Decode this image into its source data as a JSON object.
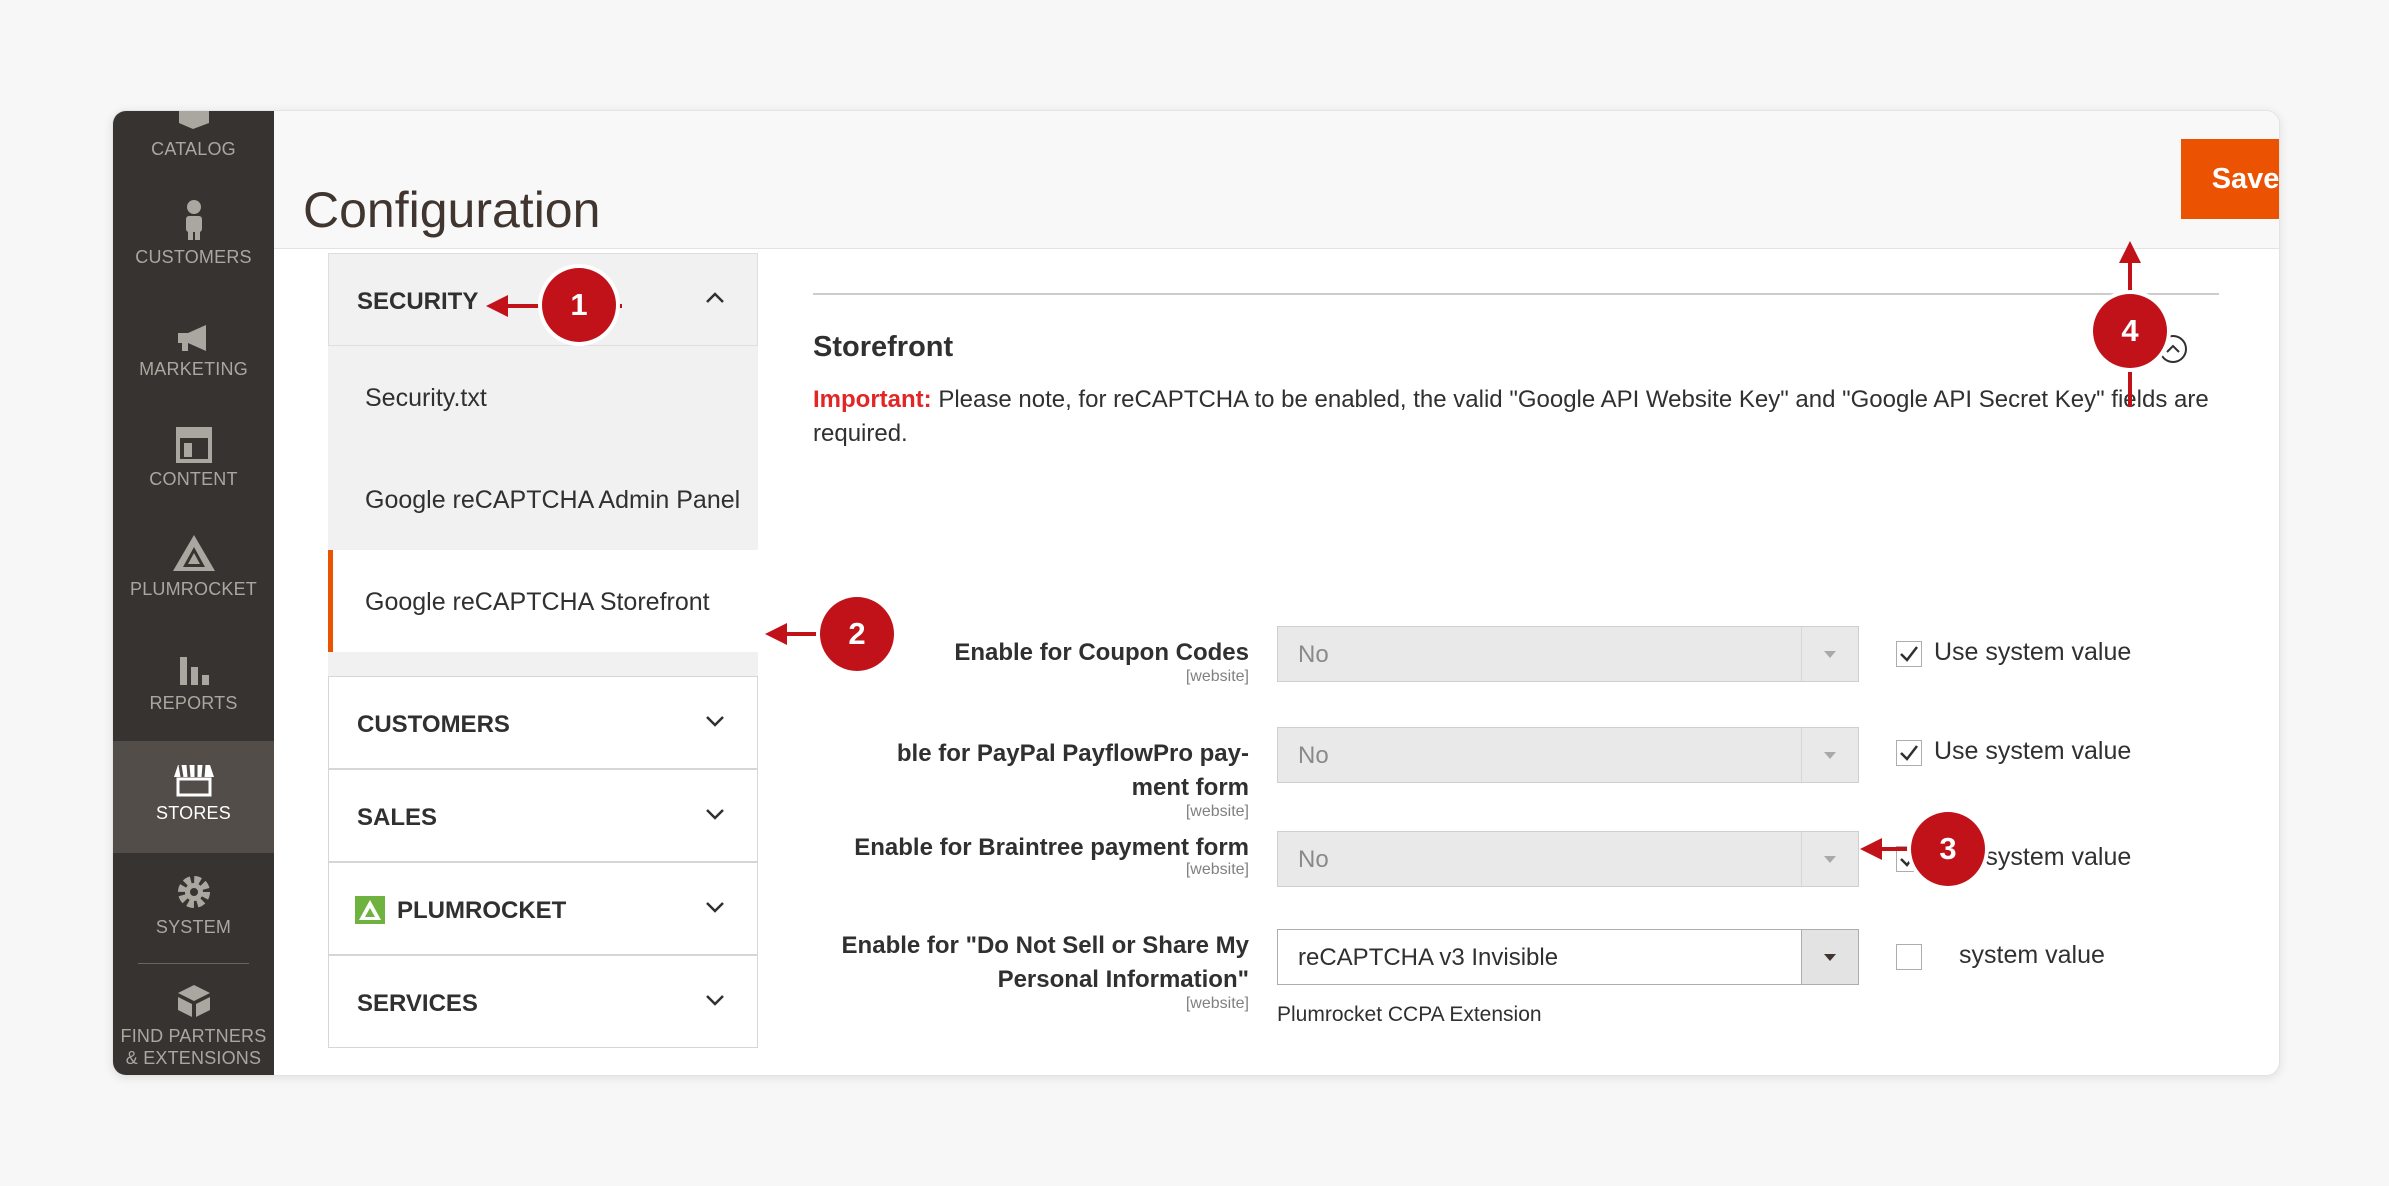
{
  "admin_menu": {
    "items": [
      {
        "label": "CATALOG",
        "icon": "catalog-icon"
      },
      {
        "label": "CUSTOMERS",
        "icon": "customers-icon"
      },
      {
        "label": "MARKETING",
        "icon": "marketing-icon"
      },
      {
        "label": "CONTENT",
        "icon": "content-icon"
      },
      {
        "label": "PLUMROCKET",
        "icon": "plumrocket-icon"
      },
      {
        "label": "REPORTS",
        "icon": "reports-icon"
      },
      {
        "label": "STORES",
        "icon": "stores-icon",
        "active": true
      },
      {
        "label": "SYSTEM",
        "icon": "system-icon"
      },
      {
        "label": "FIND PARTNERS",
        "label2": "& EXTENSIONS",
        "icon": "partners-icon"
      }
    ]
  },
  "header": {
    "title": "Configuration",
    "save_label": "Save Config"
  },
  "tabs": {
    "security": {
      "label": "SECURITY",
      "items": [
        "Security.txt",
        "Google reCAPTCHA Admin Panel",
        "Google reCAPTCHA Storefront"
      ]
    },
    "customers": {
      "label": "CUSTOMERS"
    },
    "sales": {
      "label": "SALES"
    },
    "plumrocket": {
      "label": "PLUMROCKET"
    },
    "services": {
      "label": "SERVICES"
    }
  },
  "section": {
    "title": "Storefront",
    "important_label": "Important:",
    "important_text": " Please note, for reCAPTCHA to be enabled, the valid \"Google API Website Key\" and \"Google API Secret Key\" fields are required.",
    "rows": [
      {
        "label": "Enable for Coupon Codes",
        "scope": "[website]",
        "value": "No",
        "system_value": "Use system value"
      },
      {
        "label_line1": "ble for PayPal PayflowPro pay-",
        "label_line2": "ment form",
        "scope": "[website]",
        "value": "No",
        "system_value": "Use system value"
      },
      {
        "label": "Enable for Braintree payment form",
        "scope": "[website]",
        "value": "No",
        "system_value": "Use system value"
      },
      {
        "label_line1": "Enable for \"Do Not Sell or Share My",
        "label_line2": "Personal Information\"",
        "scope": "[website]",
        "value": "reCAPTCHA v3 Invisible",
        "system_value": "system value",
        "note": "Plumrocket CCPA Extension"
      }
    ]
  },
  "callouts": [
    "1",
    "2",
    "3",
    "4"
  ],
  "colors": {
    "accent": "#eb5202",
    "callout": "#c1121a",
    "sidebar": "#373330",
    "important": "#e22626"
  }
}
